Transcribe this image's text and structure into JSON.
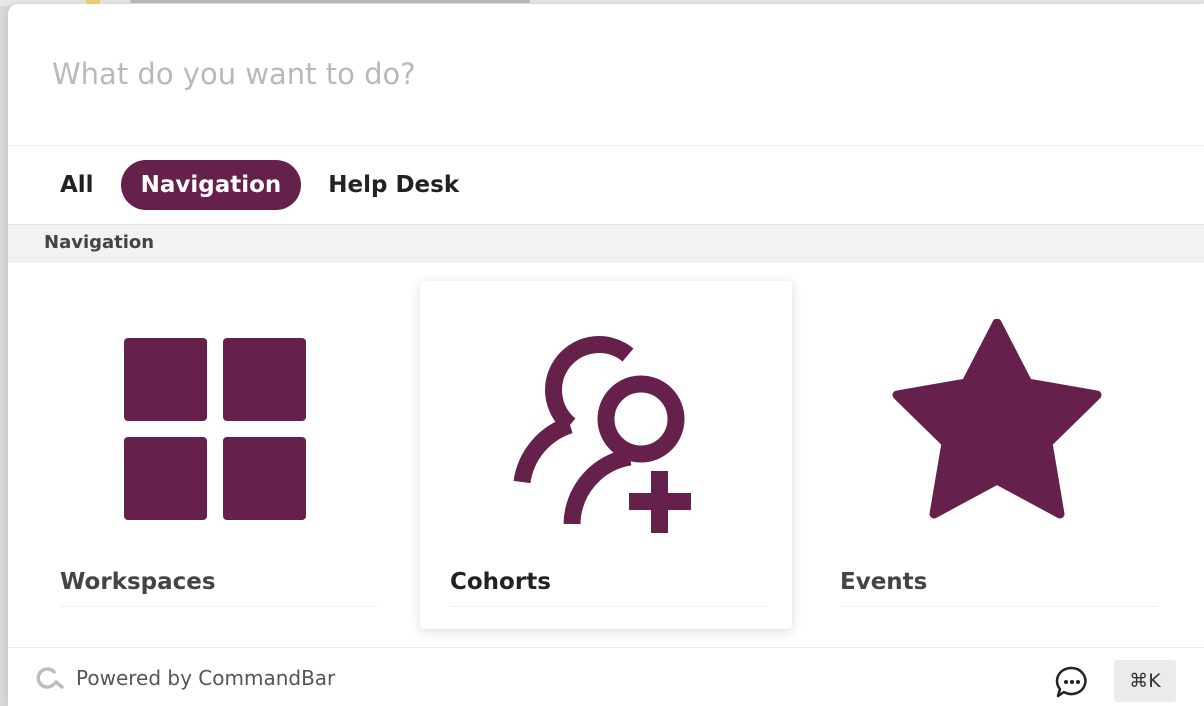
{
  "search": {
    "placeholder": "What do you want to do?",
    "value": ""
  },
  "tabs": [
    {
      "label": "All",
      "active": false
    },
    {
      "label": "Navigation",
      "active": true
    },
    {
      "label": "Help Desk",
      "active": false
    }
  ],
  "section": {
    "title": "Navigation"
  },
  "items": [
    {
      "label": "Workspaces",
      "icon": "grid-icon",
      "selected": false
    },
    {
      "label": "Cohorts",
      "icon": "add-users-icon",
      "selected": true
    },
    {
      "label": "Events",
      "icon": "star-icon",
      "selected": false
    }
  ],
  "footer": {
    "powered_by": "Powered by CommandBar",
    "shortcut": "⌘K",
    "chat_icon": "chat-bubble-icon",
    "logo_icon": "commandbar-logo-icon"
  },
  "colors": {
    "accent": "#65214b",
    "section_bg": "#f2f2f2",
    "placeholder": "#b9b9b9"
  }
}
